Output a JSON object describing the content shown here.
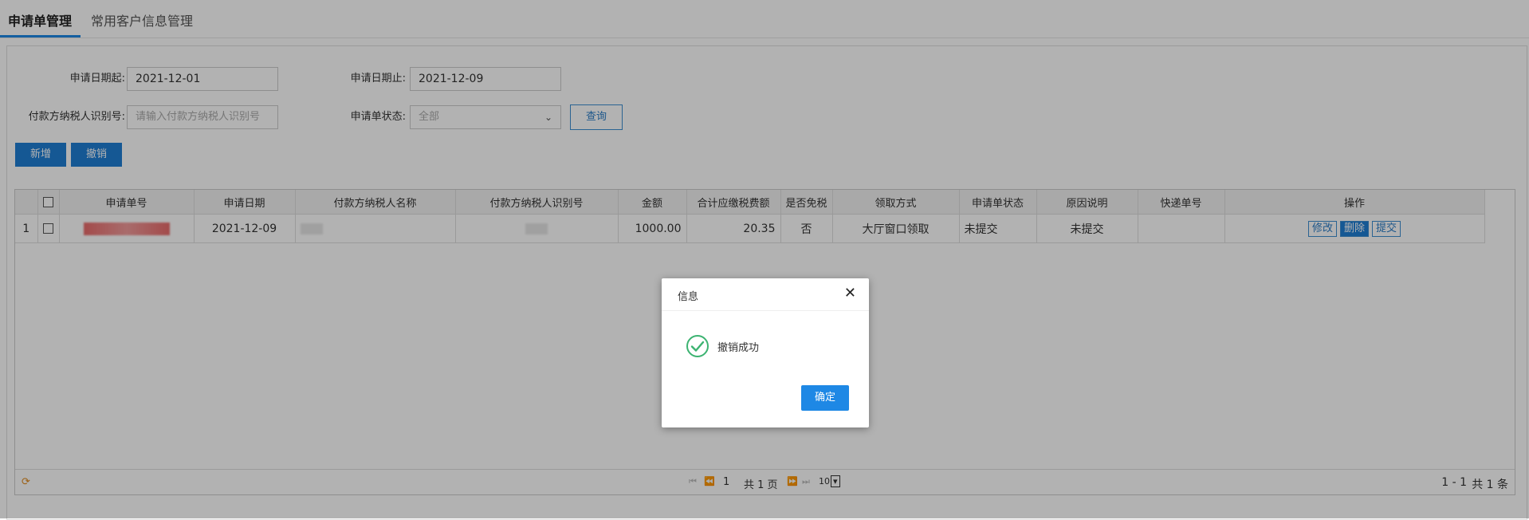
{
  "tabs": {
    "apply": "申请单管理",
    "customers": "常用客户信息管理"
  },
  "filters": {
    "date_start_label": "申请日期起:",
    "date_start_value": "2021-12-01",
    "date_end_label": "申请日期止:",
    "date_end_value": "2021-12-09",
    "taxid_label": "付款方纳税人识别号:",
    "taxid_placeholder": "请输入付款方纳税人识别号",
    "status_label": "申请单状态:",
    "status_value": "全部",
    "query_label": "查询"
  },
  "toolbar": {
    "add_label": "新增",
    "revoke_label": "撤销"
  },
  "table": {
    "headers": [
      "申请单号",
      "申请日期",
      "付款方纳税人名称",
      "付款方纳税人识别号",
      "金额",
      "合计应缴税费额",
      "是否免税",
      "领取方式",
      "申请单状态",
      "原因说明",
      "快递单号",
      "操作"
    ],
    "rows": [
      {
        "index": "1",
        "date": "2021-12-09",
        "amount": "1000.00",
        "tax": "20.35",
        "exempt": "否",
        "pickup": "大厅窗口领取",
        "status": "未提交",
        "reason": "未提交",
        "express": "",
        "actions": {
          "edit": "修改",
          "delete": "删除",
          "submit": "提交"
        }
      }
    ]
  },
  "pager": {
    "current_page": "1",
    "total_pages": "共 1 页",
    "page_size": "10",
    "range": "1 - 1",
    "total": "共 1 条"
  },
  "dialog": {
    "title": "信息",
    "message": "撤销成功",
    "ok_label": "确定",
    "success_color": "#3cb371"
  }
}
